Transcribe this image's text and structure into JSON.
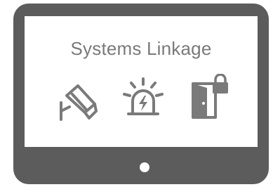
{
  "display": {
    "title": "Systems Linkage"
  },
  "icons": [
    {
      "name": "cctv-camera-icon"
    },
    {
      "name": "alarm-siren-icon"
    },
    {
      "name": "locked-door-icon"
    }
  ],
  "colors": {
    "bezel": "#5c5c5c",
    "screen": "#ffffff",
    "icon": "#7a7a7a",
    "text": "#7a7a7a"
  }
}
